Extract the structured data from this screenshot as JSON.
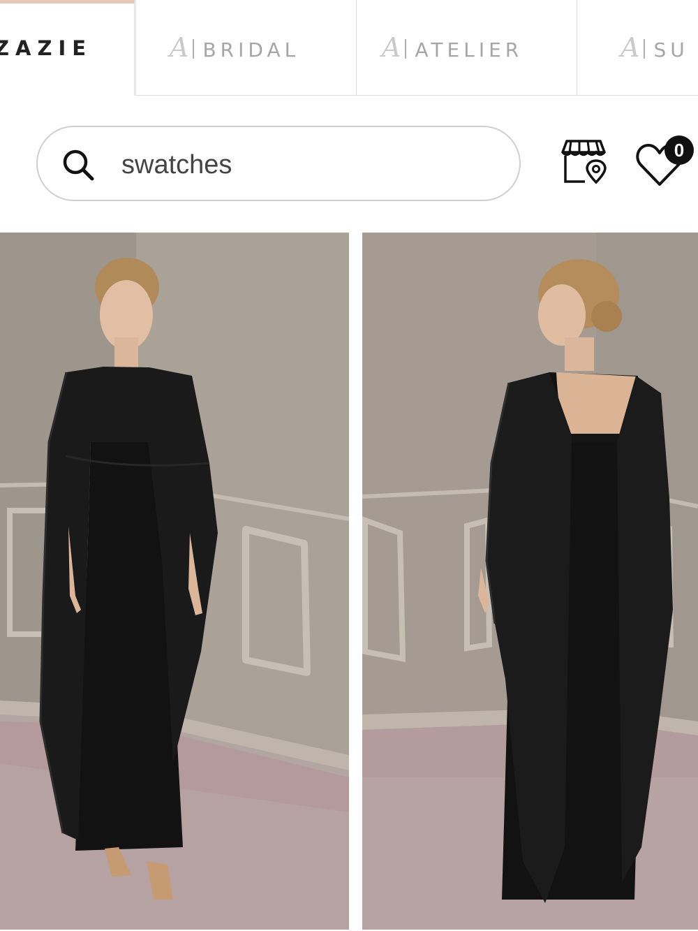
{
  "brand_tabs": [
    {
      "label": "ZAZIE",
      "active": true
    },
    {
      "label": "BRIDAL",
      "active": false
    },
    {
      "label": "ATELIER",
      "active": false
    },
    {
      "label": "SU",
      "active": false
    }
  ],
  "search": {
    "value": "swatches",
    "placeholder": "swatches"
  },
  "header_icons": {
    "store_locator": "store-location-icon",
    "wishlist": "heart-icon",
    "wishlist_count": "0"
  },
  "gallery": {
    "images": [
      {
        "name": "dress-front-photo"
      },
      {
        "name": "dress-back-photo"
      }
    ]
  },
  "colors": {
    "accent": "#e8c9b7",
    "wall": "#a79d93",
    "dress": "#121212"
  }
}
